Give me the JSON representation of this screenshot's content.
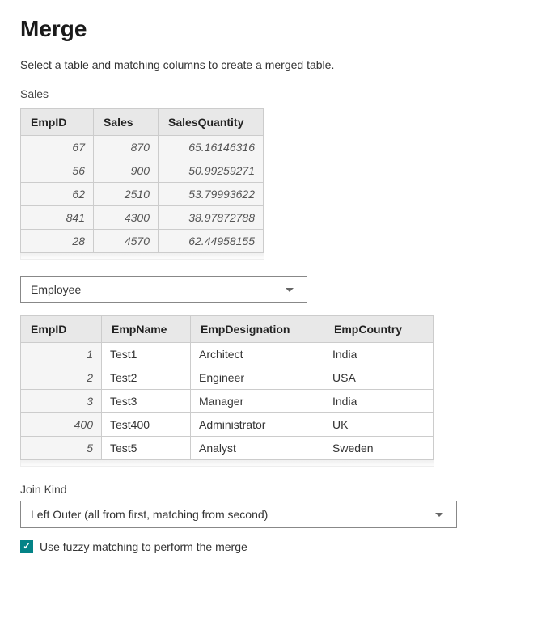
{
  "title": "Merge",
  "description": "Select a table and matching columns to create a merged table.",
  "table1": {
    "label": "Sales",
    "columns": [
      "EmpID",
      "Sales",
      "SalesQuantity"
    ],
    "rows": [
      {
        "empid": "67",
        "sales": "870",
        "qty": "65.16146316"
      },
      {
        "empid": "56",
        "sales": "900",
        "qty": "50.99259271"
      },
      {
        "empid": "62",
        "sales": "2510",
        "qty": "53.79993622"
      },
      {
        "empid": "841",
        "sales": "4300",
        "qty": "38.97872788"
      },
      {
        "empid": "28",
        "sales": "4570",
        "qty": "62.44958155"
      }
    ]
  },
  "table2_selector": {
    "selected": "Employee"
  },
  "table2": {
    "columns": [
      "EmpID",
      "EmpName",
      "EmpDesignation",
      "EmpCountry"
    ],
    "rows": [
      {
        "empid": "1",
        "name": "Test1",
        "desig": "Architect",
        "country": "India"
      },
      {
        "empid": "2",
        "name": "Test2",
        "desig": "Engineer",
        "country": "USA"
      },
      {
        "empid": "3",
        "name": "Test3",
        "desig": "Manager",
        "country": "India"
      },
      {
        "empid": "400",
        "name": "Test400",
        "desig": "Administrator",
        "country": "UK"
      },
      {
        "empid": "5",
        "name": "Test5",
        "desig": "Analyst",
        "country": "Sweden"
      }
    ]
  },
  "join_kind": {
    "label": "Join Kind",
    "selected": "Left Outer (all from first, matching from second)"
  },
  "fuzzy": {
    "label": "Use fuzzy matching to perform the merge",
    "checked": true
  }
}
